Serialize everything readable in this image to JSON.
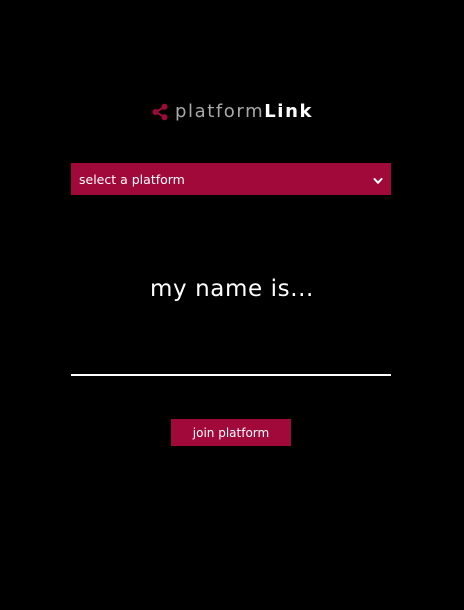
{
  "logo": {
    "text_light": "platform",
    "text_bold": "Link",
    "icon": "share-icon"
  },
  "platform_select": {
    "selected_label": "select a platform",
    "icon": "chevron-down-icon"
  },
  "prompt": {
    "text": "my name is..."
  },
  "name_input": {
    "value": "",
    "placeholder": ""
  },
  "join_button": {
    "label": "join platform"
  },
  "colors": {
    "background": "#000000",
    "accent": "#a0093a",
    "text": "#ffffff",
    "logo_light": "#a9a9a9"
  }
}
